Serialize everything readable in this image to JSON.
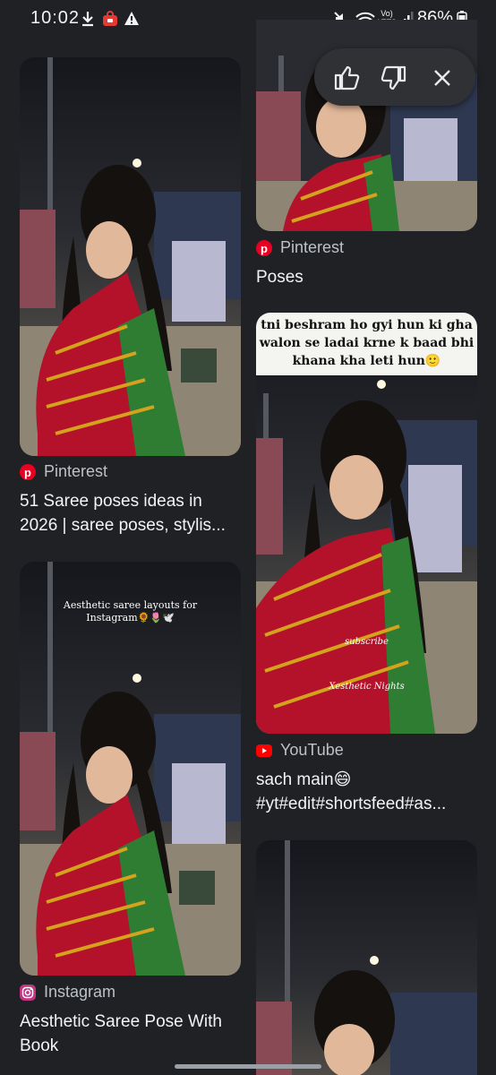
{
  "status_bar": {
    "time": "10:02",
    "battery": "86%",
    "network": "Vo) LTE2"
  },
  "feedback_popup": {
    "icons": [
      "thumbs-up-icon",
      "thumbs-down-icon",
      "close-icon"
    ]
  },
  "left_column": [
    {
      "source": "Pinterest",
      "title": "51 Saree poses ideas in 2026 | saree poses, stylis...",
      "source_icon": "pinterest-icon"
    },
    {
      "overlay_caption": "Aesthetic saree layouts for Instagram🌻🌷🕊️",
      "source": "Instagram",
      "title": "Aesthetic Saree Pose With Book",
      "source_icon": "instagram-icon"
    }
  ],
  "right_column": [
    {
      "source": "Pinterest",
      "title": "Poses",
      "source_icon": "pinterest-icon"
    },
    {
      "overlay_caption": "tni beshram ho gyi hun ki gha walon se ladai krne k baad bhi khana kha leti hun🙂",
      "watermark_1": "subscribe",
      "watermark_2": "Xesthetic Nights",
      "source": "YouTube",
      "title": "sach main😄 #yt#edit#shortsfeed#as...",
      "source_icon": "youtube-icon"
    },
    {
      "source": "",
      "title": ""
    }
  ],
  "colors": {
    "background": "#202124",
    "pinterest": "#e60023",
    "youtube": "#ff0000",
    "instagram": "#c13584",
    "saree_red": "#b3122a",
    "saree_green": "#2e7d32",
    "gold": "#d4a21c"
  }
}
